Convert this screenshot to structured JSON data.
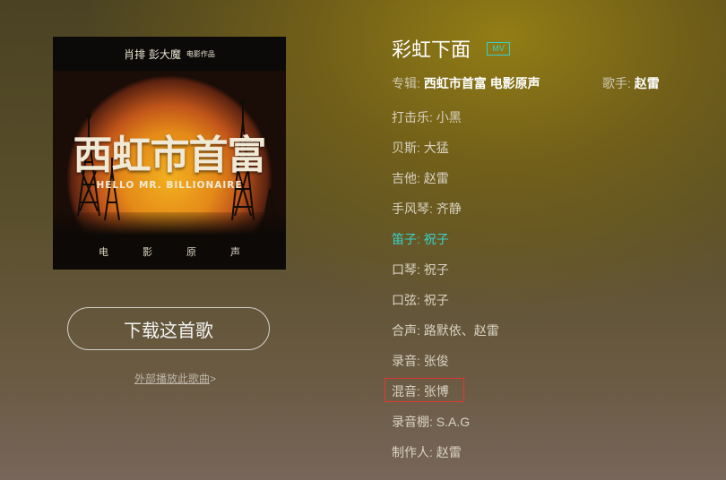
{
  "cover": {
    "top_names": "肖排   彭大魔",
    "top_small": "电影作品",
    "title_cn": "西虹市首富",
    "title_en": "HELLO MR. BILLIONAIRE",
    "caption": "电影原声"
  },
  "download_button": "下载这首歌",
  "external_link": {
    "text": "外部播放此歌曲",
    "arrow": ">"
  },
  "song": {
    "title": "彩虹下面",
    "mv_badge": "MV",
    "album_label": "专辑:",
    "album_value": "西虹市首富 电影原声",
    "singer_label": "歌手:",
    "singer_value": "赵雷"
  },
  "credits": [
    {
      "text": "打击乐: 小黑",
      "active": false
    },
    {
      "text": "贝斯: 大猛",
      "active": false
    },
    {
      "text": "吉他: 赵雷",
      "active": false
    },
    {
      "text": "手风琴: 齐静",
      "active": false
    },
    {
      "text": "笛子: 祝子",
      "active": true
    },
    {
      "text": "口琴: 祝子",
      "active": false
    },
    {
      "text": "口弦: 祝子",
      "active": false
    },
    {
      "text": "合声: 路默依、赵雷",
      "active": false
    },
    {
      "text": "录音: 张俊",
      "active": false
    },
    {
      "text": "混音: 张博",
      "active": false
    },
    {
      "text": "录音棚: S.A.G",
      "active": false
    },
    {
      "text": "制作人: 赵雷",
      "active": false
    }
  ],
  "colors": {
    "accent": "#37d3cb",
    "highlight_border": "#e0392f"
  }
}
